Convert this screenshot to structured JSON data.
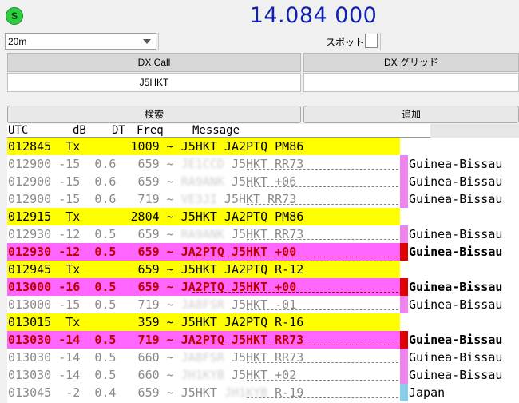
{
  "status_indicator": "S",
  "frequency": "14.084 000",
  "band": "20m",
  "spot_label": "スポット",
  "dx_call_header": "DX Call",
  "dx_grid_header": "DX グリッド",
  "dx_call_value": "J5HKT",
  "dx_grid_value": "",
  "search_label": "検索",
  "add_label": "追加",
  "columns": {
    "utc": "UTC",
    "db": "dB",
    "dt": "DT",
    "freq": "Freq",
    "message": "Message"
  },
  "colors": {
    "tx_bg": "#ffff00",
    "mine_bg": "#ff66ff",
    "mine_text": "#c00000",
    "cq_text": "#8a8a8a",
    "marker_pink": "#ee82ee",
    "marker_red": "#e00000",
    "marker_blue": "#87ceeb"
  },
  "rows": [
    {
      "kind": "tx",
      "text": "012845  Tx       1009 ~ J5HKT JA2PTQ PM86",
      "blur": "",
      "blur_after": "",
      "country": "",
      "marker": ""
    },
    {
      "kind": "cq",
      "text": "012900 -15  0.6   659 ~ ",
      "blur": "JE1CCD",
      "blur_after": " J5HKT RR73",
      "country": "Guinea-Bissau",
      "marker": "pink"
    },
    {
      "kind": "cq",
      "text": "012900 -15  0.6   659 ~ ",
      "blur": "RA9ANK",
      "blur_after": " J5HKT +06",
      "country": "Guinea-Bissau",
      "marker": "pink"
    },
    {
      "kind": "cq",
      "text": "012900 -15  0.6   719 ~ ",
      "blur": "VE3JI",
      "blur_after": " J5HKT RR73",
      "country": "Guinea-Bissau",
      "marker": "pink"
    },
    {
      "kind": "tx",
      "text": "012915  Tx       2804 ~ J5HKT JA2PTQ PM86",
      "blur": "",
      "blur_after": "",
      "country": "",
      "marker": ""
    },
    {
      "kind": "cq",
      "text": "012930 -12  0.5   659 ~ ",
      "blur": "RA9ANK",
      "blur_after": " J5HKT RR73",
      "country": "Guinea-Bissau",
      "marker": "pink"
    },
    {
      "kind": "mine",
      "text": "012930 -12  0.5   659 ~ JA2PTQ J5HKT +00",
      "blur": "",
      "blur_after": "",
      "country": "Guinea-Bissau",
      "marker": "red"
    },
    {
      "kind": "tx",
      "text": "012945  Tx        659 ~ J5HKT JA2PTQ R-12",
      "blur": "",
      "blur_after": "",
      "country": "",
      "marker": ""
    },
    {
      "kind": "mine",
      "text": "013000 -16  0.5   659 ~ JA2PTQ J5HKT +00",
      "blur": "",
      "blur_after": "",
      "country": "Guinea-Bissau",
      "marker": "red"
    },
    {
      "kind": "cq",
      "text": "013000 -15  0.5   719 ~ ",
      "blur": "JA8FSR",
      "blur_after": " J5HKT -01",
      "country": "Guinea-Bissau",
      "marker": "pink"
    },
    {
      "kind": "tx",
      "text": "013015  Tx        359 ~ J5HKT JA2PTQ R-16",
      "blur": "",
      "blur_after": "",
      "country": "",
      "marker": ""
    },
    {
      "kind": "mine",
      "text": "013030 -14  0.5   719 ~ JA2PTQ J5HKT RR73",
      "blur": "",
      "blur_after": "",
      "country": "Guinea-Bissau",
      "marker": "red"
    },
    {
      "kind": "cq",
      "text": "013030 -14  0.5   660 ~ ",
      "blur": "JA8FSR",
      "blur_after": " J5HKT RR73",
      "country": "Guinea-Bissau",
      "marker": "pink"
    },
    {
      "kind": "cq",
      "text": "013030 -14  0.5   660 ~ ",
      "blur": "JH1KYB",
      "blur_after": " J5HKT +02",
      "country": "Guinea-Bissau",
      "marker": "pink"
    },
    {
      "kind": "cq",
      "text": "013045  -2  0.4   659 ~ J5HKT ",
      "blur": "JH1KYB",
      "blur_after": " R-19",
      "country": "Japan",
      "marker": "blue"
    }
  ]
}
